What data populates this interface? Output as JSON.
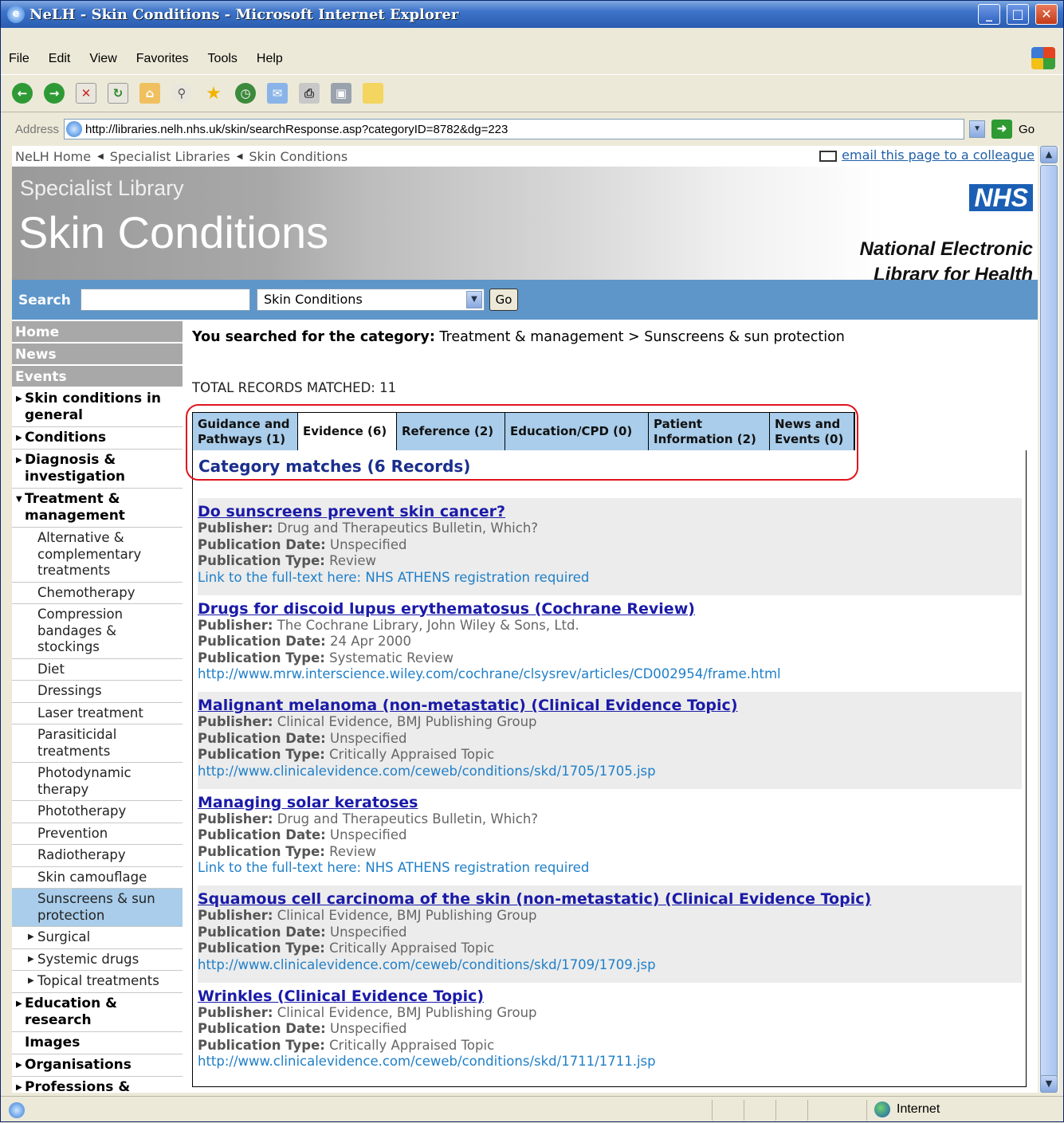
{
  "window": {
    "title": "NeLH - Skin Conditions - Microsoft Internet Explorer"
  },
  "menu": [
    "File",
    "Edit",
    "View",
    "Favorites",
    "Tools",
    "Help"
  ],
  "address": {
    "label": "Address",
    "url": "http://libraries.nelh.nhs.uk/skin/searchResponse.asp?categoryID=8782&dg=223",
    "go": "Go"
  },
  "breadcrumb": {
    "items": [
      "NeLH Home",
      "Specialist Libraries",
      "Skin Conditions"
    ],
    "email": "email this page to a colleague"
  },
  "banner": {
    "subtitle": "Specialist Library",
    "title": "Skin Conditions",
    "logo": "NHS",
    "org_line1": "National Electronic",
    "org_line2": "Library for Health"
  },
  "search": {
    "label": "Search",
    "value": "",
    "scope": "Skin Conditions",
    "go": "Go"
  },
  "nav": {
    "top": [
      "Home",
      "News",
      "Events"
    ],
    "sections": [
      {
        "label": "Skin conditions in general"
      },
      {
        "label": "Conditions"
      },
      {
        "label": "Diagnosis & investigation"
      },
      {
        "label": "Treatment & management"
      }
    ],
    "sub": [
      "Alternative & complementary treatments",
      "Chemotherapy",
      "Compression bandages & stockings",
      "Diet",
      "Dressings",
      "Laser treatment",
      "Parasiticidal treatments",
      "Photodynamic therapy",
      "Phototherapy",
      "Prevention",
      "Radiotherapy",
      "Skin camouflage",
      "Sunscreens & sun protection",
      "Surgical",
      "Systemic drugs",
      "Topical treatments"
    ],
    "after": [
      {
        "label": "Education & research"
      },
      {
        "label": "Images"
      },
      {
        "label": "Organisations"
      },
      {
        "label": "Professions & specialities"
      }
    ]
  },
  "main": {
    "searched_label": "You searched for the category:",
    "searched_path": "Treatment & management > Sunscreens & sun protection",
    "total": "TOTAL RECORDS MATCHED: 11",
    "tabs": [
      "Guidance and Pathways (1)",
      "Evidence (6)",
      "Reference (2)",
      "Education/CPD (0)",
      "Patient Information (2)",
      "News and Events (0)"
    ],
    "category_matches": "Category matches (6 Records)",
    "labels": {
      "publisher": "Publisher:",
      "date": "Publication Date:",
      "type": "Publication Type:"
    },
    "records": [
      {
        "title": "Do sunscreens prevent skin cancer?",
        "publisher": "Drug and Therapeutics Bulletin, Which?",
        "date": "Unspecified",
        "type": "Review",
        "link": "Link to the full-text here: NHS ATHENS registration required"
      },
      {
        "title": "Drugs for discoid lupus erythematosus (Cochrane Review)",
        "publisher": "The Cochrane Library, John Wiley & Sons, Ltd.",
        "date": "24 Apr 2000",
        "type": "Systematic Review",
        "link": "http://www.mrw.interscience.wiley.com/cochrane/clsysrev/articles/CD002954/frame.html"
      },
      {
        "title": "Malignant melanoma (non-metastatic) (Clinical Evidence Topic)",
        "publisher": "Clinical Evidence, BMJ Publishing Group",
        "date": "Unspecified",
        "type": "Critically Appraised Topic",
        "link": "http://www.clinicalevidence.com/ceweb/conditions/skd/1705/1705.jsp"
      },
      {
        "title": "Managing solar keratoses",
        "publisher": "Drug and Therapeutics Bulletin, Which?",
        "date": "Unspecified",
        "type": "Review",
        "link": "Link to the full-text here: NHS ATHENS registration required"
      },
      {
        "title": "Squamous cell carcinoma of the skin (non-metastatic) (Clinical Evidence Topic)",
        "publisher": "Clinical Evidence, BMJ Publishing Group",
        "date": "Unspecified",
        "type": "Critically Appraised Topic",
        "link": "http://www.clinicalevidence.com/ceweb/conditions/skd/1709/1709.jsp"
      },
      {
        "title": "Wrinkles (Clinical Evidence Topic)",
        "publisher": "Clinical Evidence, BMJ Publishing Group",
        "date": "Unspecified",
        "type": "Critically Appraised Topic",
        "link": "http://www.clinicalevidence.com/ceweb/conditions/skd/1711/1711.jsp"
      }
    ]
  },
  "status": {
    "zone": "Internet"
  },
  "colors": {
    "accent": "#5e96c9",
    "tab": "#a9cdea",
    "link": "#1a1aa8",
    "highlight": "#e0141e"
  }
}
